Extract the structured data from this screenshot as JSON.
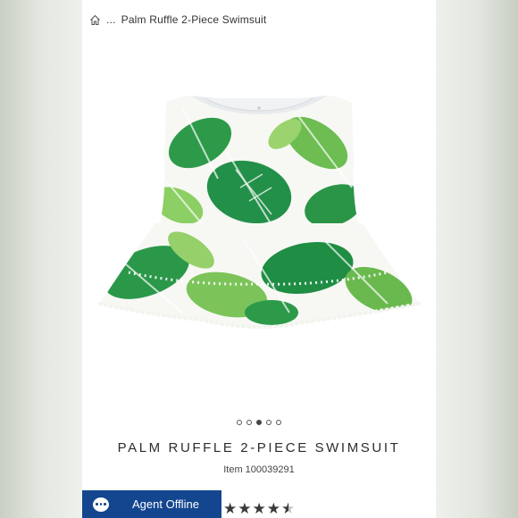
{
  "breadcrumb": {
    "ellipsis": "...",
    "current": "Palm Ruffle 2-Piece Swimsuit"
  },
  "carousel": {
    "slide_count": 5,
    "active_index": 2
  },
  "product": {
    "title": "PALM RUFFLE 2-PIECE SWIMSUIT",
    "item_number": "Item 100039291",
    "rating": 4.5,
    "rating_max": 5
  },
  "chat": {
    "label": "Agent Offline"
  },
  "colors": {
    "chat_bg": "#14468f",
    "leaf_dark": "#1e8a3c",
    "leaf_light": "#7cc45a"
  },
  "icons": {
    "home": "home-icon",
    "chat": "chat-bubble-icon",
    "star": "star-icon"
  }
}
